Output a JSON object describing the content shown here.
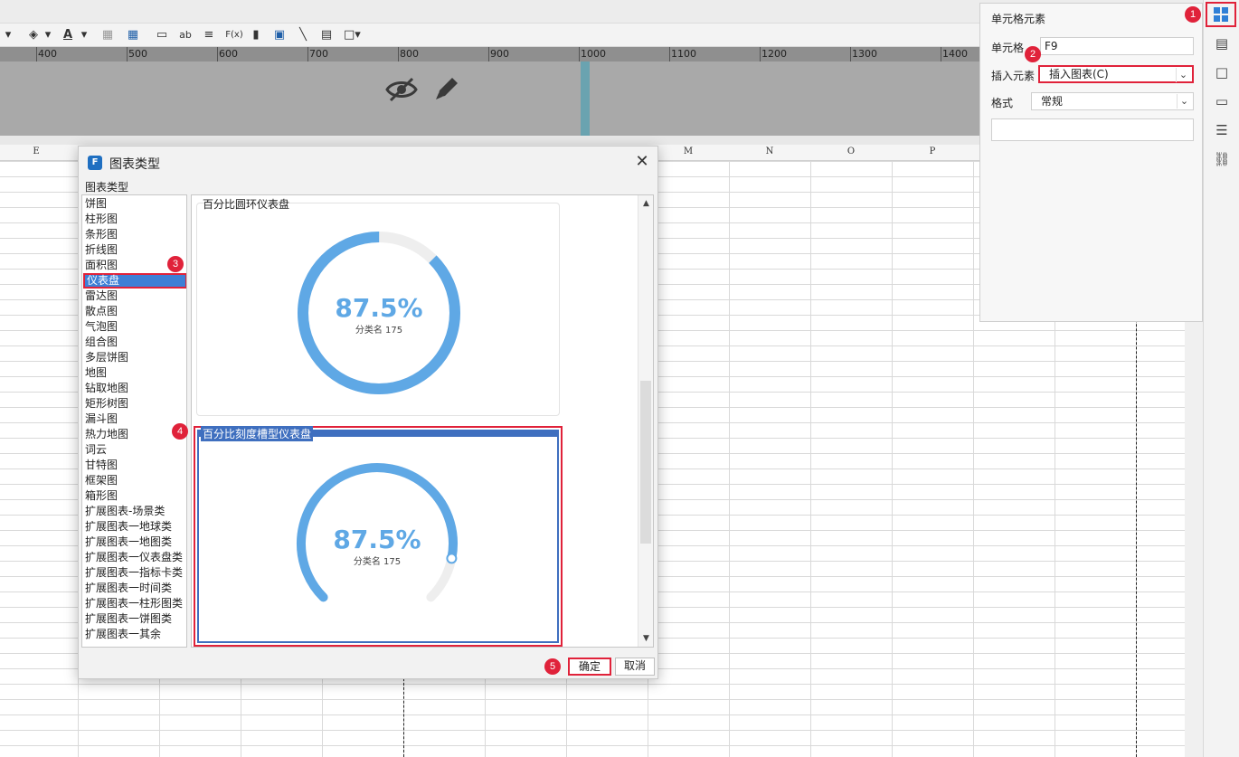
{
  "toolbar": {
    "icons": [
      "dropdown-arrow-icon",
      "fill-color-icon",
      "dropdown-arrow-icon",
      "font-color-icon",
      "dropdown-arrow-icon",
      "border-icon",
      "table-icon",
      "textbox-icon",
      "text-icon",
      "align-icon",
      "formula-icon",
      "bar-chart-icon",
      "image-icon",
      "slash-icon",
      "page-icon",
      "border-style-icon"
    ],
    "font_color_label": "A",
    "text_label": "ab",
    "formula_label": "F(x)"
  },
  "ruler": {
    "ticks": [
      "400",
      "500",
      "600",
      "700",
      "800",
      "900",
      "1000",
      "1100",
      "1200",
      "1300",
      "1400"
    ]
  },
  "columns": [
    "E",
    "M",
    "N",
    "O",
    "P"
  ],
  "panel": {
    "title": "单元格元素",
    "cell_label": "单元格",
    "cell_value": "F9",
    "insert_label": "插入元素",
    "insert_value": "插入图表(C)",
    "format_label": "格式",
    "format_value": "常规"
  },
  "badges": {
    "b1": "1",
    "b2": "2",
    "b3": "3",
    "b4": "4",
    "b5": "5"
  },
  "dialog": {
    "title": "图表类型",
    "group_label": "图表类型",
    "chart_types": [
      "饼图",
      "柱形图",
      "条形图",
      "折线图",
      "面积图",
      "仪表盘",
      "雷达图",
      "散点图",
      "气泡图",
      "组合图",
      "多层饼图",
      "地图",
      "钻取地图",
      "矩形树图",
      "漏斗图",
      "热力地图",
      "词云",
      "甘特图",
      "框架图",
      "箱形图",
      "扩展图表-场景类",
      "扩展图表一地球类",
      "扩展图表一地图类",
      "扩展图表一仪表盘类",
      "扩展图表一指标卡类",
      "扩展图表一时间类",
      "扩展图表一柱形图类",
      "扩展图表一饼图类",
      "扩展图表一其余"
    ],
    "selected_index": 5,
    "previews": [
      {
        "title": "百分比圆环仪表盘",
        "value": "87.5%",
        "subtitle": "分类名 175",
        "fraction": 0.875
      },
      {
        "title": "百分比刻度槽型仪表盘",
        "value": "87.5%",
        "subtitle": "分类名 175",
        "fraction": 0.875
      }
    ],
    "ok_label": "确定",
    "cancel_label": "取消"
  },
  "colors": {
    "accent": "#5fa8e5",
    "highlight": "#e0223a",
    "track": "#eeeeee"
  }
}
